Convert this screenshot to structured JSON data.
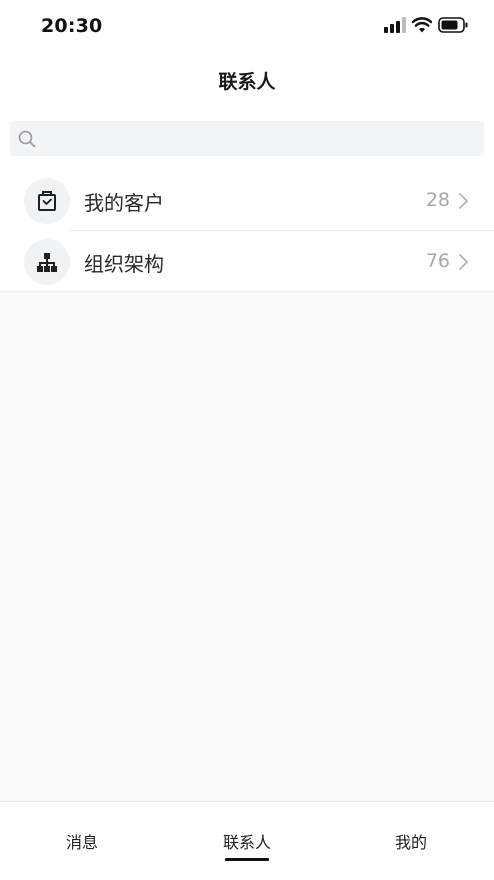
{
  "status_bar": {
    "time": "20:30",
    "icons": [
      "signal-icon",
      "wifi-icon",
      "battery-icon"
    ]
  },
  "nav": {
    "title": "联系人"
  },
  "search": {
    "value": "",
    "placeholder": ""
  },
  "list": {
    "items": [
      {
        "label": "我的客户",
        "count": "28",
        "icon": "briefcase-icon"
      },
      {
        "label": "组织架构",
        "count": "76",
        "icon": "org-chart-icon"
      }
    ]
  },
  "tabs": {
    "items": [
      {
        "label": "消息"
      },
      {
        "label": "联系人",
        "active": true
      },
      {
        "label": "我的"
      }
    ]
  },
  "colors": {
    "background": "#fafafa",
    "surface": "#ffffff",
    "search_bg": "#f3f4f6",
    "count_text": "#a8a8a8",
    "active_indicator": "#111111"
  }
}
